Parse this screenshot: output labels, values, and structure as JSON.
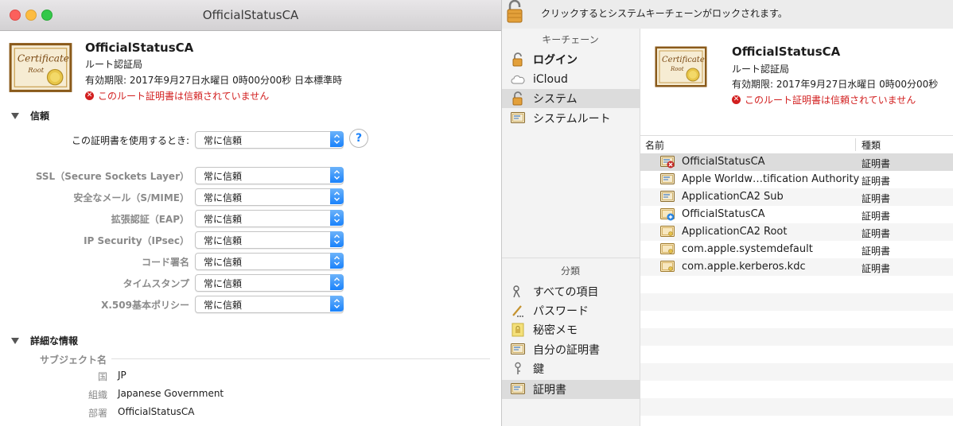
{
  "keychain": {
    "lock_text": "クリックするとシステムキーチェーンがロックされます。",
    "sidebar": {
      "keychains_header": "キーチェーン",
      "keychains": [
        {
          "label": "ログイン",
          "bold": true,
          "icon": "open-lock-icon"
        },
        {
          "label": "iCloud",
          "bold": false,
          "icon": "cloud-icon"
        },
        {
          "label": "システム",
          "bold": false,
          "icon": "open-lock-icon",
          "selected": true
        },
        {
          "label": "システムルート",
          "bold": false,
          "icon": "certificate-icon"
        }
      ],
      "category_header": "分類",
      "categories": [
        {
          "label": "すべての項目",
          "icon": "keys-icon"
        },
        {
          "label": "パスワード",
          "icon": "pen-icon"
        },
        {
          "label": "秘密メモ",
          "icon": "note-lock-icon"
        },
        {
          "label": "自分の証明書",
          "icon": "my-certificate-icon"
        },
        {
          "label": "鍵",
          "icon": "key-icon"
        },
        {
          "label": "証明書",
          "icon": "certificate-icon",
          "selected": true
        }
      ]
    },
    "detail": {
      "name": "OfficialStatusCA",
      "type": "ルート認証局",
      "expires": "有効期限: 2017年9月27日水曜日 0時00分00秒",
      "warning": "このルート証明書は信頼されていません"
    },
    "table": {
      "col_name": "名前",
      "col_kind": "種類",
      "rows": [
        {
          "name": "OfficialStatusCA",
          "kind": "証明書",
          "icon": "untrusted-certificate-icon",
          "selected": true
        },
        {
          "name": "Apple Worldw…tification Authority",
          "kind": "証明書",
          "icon": "certificate-icon"
        },
        {
          "name": "ApplicationCA2 Sub",
          "kind": "証明書",
          "icon": "certificate-icon"
        },
        {
          "name": "OfficialStatusCA",
          "kind": "証明書",
          "icon": "custom-trust-certificate-icon"
        },
        {
          "name": "ApplicationCA2 Root",
          "kind": "証明書",
          "icon": "root-certificate-icon"
        },
        {
          "name": "com.apple.systemdefault",
          "kind": "証明書",
          "icon": "root-certificate-icon"
        },
        {
          "name": "com.apple.kerberos.kdc",
          "kind": "証明書",
          "icon": "root-certificate-icon"
        }
      ]
    }
  },
  "cert_window": {
    "title": "OfficialStatusCA",
    "name": "OfficialStatusCA",
    "type": "ルート認証局",
    "expires": "有効期限: 2017年9月27日水曜日 0時00分00秒 日本標準時",
    "warning": "このルート証明書は信頼されていません",
    "trust": {
      "header": "信頼",
      "when_using_label": "この証明書を使用するとき:",
      "when_using_value": "常に信頼",
      "help": "?",
      "policies": [
        {
          "label": "SSL（Secure Sockets Layer）",
          "value": "常に信頼"
        },
        {
          "label": "安全なメール（S/MIME）",
          "value": "常に信頼"
        },
        {
          "label": "拡張認証（EAP）",
          "value": "常に信頼"
        },
        {
          "label": "IP Security（IPsec）",
          "value": "常に信頼"
        },
        {
          "label": "コード署名",
          "value": "常に信頼"
        },
        {
          "label": "タイムスタンプ",
          "value": "常に信頼"
        },
        {
          "label": "X.509基本ポリシー",
          "value": "常に信頼"
        }
      ]
    },
    "details": {
      "header": "詳細な情報",
      "subject_label": "サブジェクト名",
      "fields": [
        {
          "key": "国",
          "value": "JP"
        },
        {
          "key": "組織",
          "value": "Japanese Government"
        },
        {
          "key": "部署",
          "value": "OfficialStatusCA"
        }
      ]
    },
    "certificate_art": {
      "script": "Certificate",
      "sub": "Root"
    }
  },
  "colors": {
    "accent": "#1a82fb",
    "warning": "#d21f1f",
    "selection": "#dcdcdc"
  }
}
